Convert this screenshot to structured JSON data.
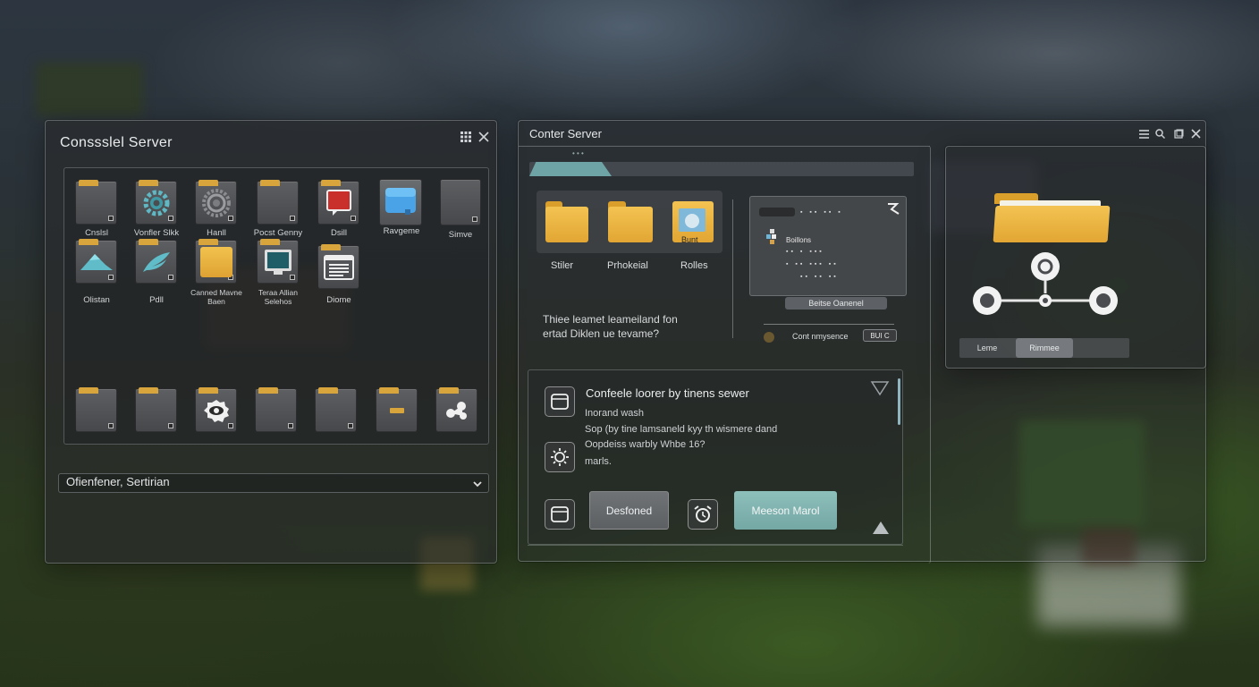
{
  "left_panel": {
    "title": "Conssslel Server",
    "grid_icon": "grid-icon",
    "close_icon": "close-icon",
    "row1": [
      {
        "label": "Cnslsl",
        "icon": "blank-tile"
      },
      {
        "label": "Vonfler Slkk",
        "icon": "gear-icon"
      },
      {
        "label": "Hanll",
        "icon": "cog-icon"
      },
      {
        "label": "Pocst Genny",
        "icon": "blank-tile"
      },
      {
        "label": "Dsill",
        "icon": "chat-bubble-icon"
      },
      {
        "label": "Ravgeme",
        "icon": "blue-card-icon"
      },
      {
        "label": "Simve",
        "icon": "blank-tile"
      }
    ],
    "row2": [
      {
        "label": "Olistan",
        "icon": "mountain-icon"
      },
      {
        "label": "Pdll",
        "icon": "feather-icon"
      },
      {
        "label": "Canned Mavne\nBaen",
        "icon": "folder-icon"
      },
      {
        "label": "Teraa Allian\nSelehos",
        "icon": "monitor-icon"
      },
      {
        "label": "Diome",
        "icon": "document-icon"
      }
    ],
    "row3": [
      {
        "icon": "blank-tile"
      },
      {
        "icon": "blank-tile"
      },
      {
        "icon": "eye-icon"
      },
      {
        "icon": "blank-tile"
      },
      {
        "icon": "blank-tile"
      },
      {
        "icon": "small-folder-icon"
      },
      {
        "icon": "share-icon"
      }
    ],
    "dropdown_value": "Ofienfener, Sertirian"
  },
  "center_panel": {
    "title": "Conter Server",
    "window_icons": [
      "menu-icon",
      "search-icon",
      "restore-icon",
      "close-icon"
    ],
    "folders": [
      {
        "label": "Stiler"
      },
      {
        "label": "Prhokeial"
      },
      {
        "label": "Rolles",
        "badge": "Bunt"
      }
    ],
    "question": [
      "Thiee leamet leameiland fon",
      "ertad Diklen ue tevame?"
    ],
    "preview": {
      "rows": [
        "Boillons"
      ],
      "button": "Beitse Oanenel",
      "footer_label": "Cont nmysence",
      "footer_badge": "BUI C"
    },
    "lower": {
      "heading": "Confeele loorer by tinens sewer",
      "line1": "Inorand wash",
      "line2": "Sop (by tine lamsaneld kyy th wismere dand",
      "line3": "Oopdeiss warbly Whbe 16?",
      "line4": "marls.",
      "button_primary": "Desfoned",
      "button_accent": "Meeson Marol"
    }
  },
  "right_panel": {
    "tabs": [
      {
        "label": "Leme"
      },
      {
        "label": "Rimmee"
      },
      {
        "label": ""
      }
    ]
  },
  "colors": {
    "accent_teal": "#7fb2ae",
    "folder_yellow": "#e8ad36",
    "panel_border": "#c8cdd2"
  }
}
